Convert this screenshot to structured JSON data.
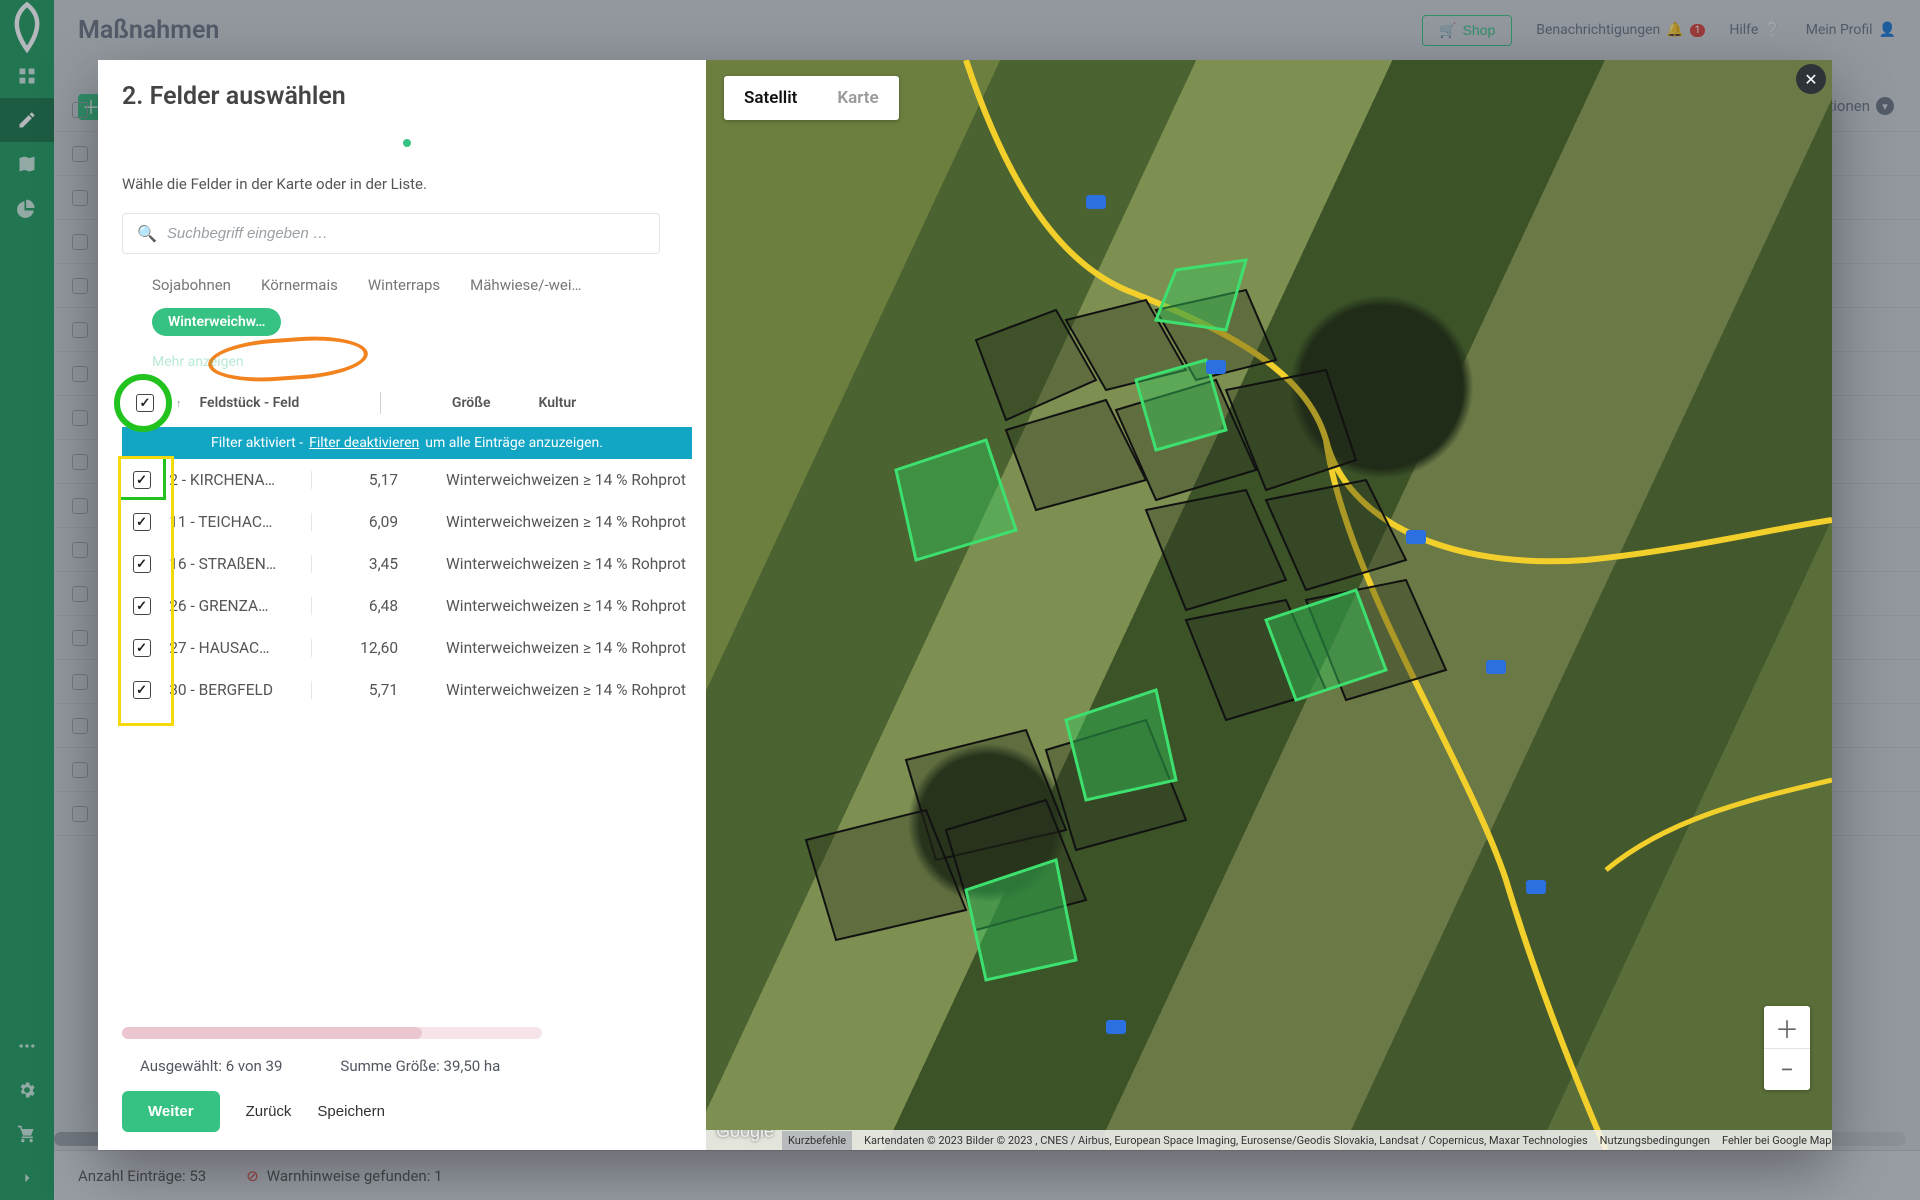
{
  "header": {
    "title": "Maßnahmen",
    "shop": "Shop",
    "notifications": "Benachrichtigungen",
    "notif_badge": "1",
    "help": "Hilfe",
    "profile": "Mein Profil",
    "actions": "tionen"
  },
  "modal": {
    "title": "2. Felder auswählen",
    "hint": "Wähle die Felder in der Karte oder in der Liste.",
    "search_placeholder": "Suchbegriff eingeben …",
    "crop_filters": [
      "Sojabohnen",
      "Körnermais",
      "Winterraps",
      "Mähwiese/-wei…"
    ],
    "crop_active": "Winterweichw…",
    "show_more": "Mehr anzeigen",
    "columns": {
      "field": "Feldstück - Feld",
      "size": "Größe",
      "culture": "Kultur"
    },
    "filter_banner": {
      "pre": "Filter aktiviert - ",
      "link": "Filter deaktivieren",
      "post": " um alle Einträge anzuzeigen."
    },
    "rows": [
      {
        "field": "2 - KIRCHENA…",
        "size": "5,17",
        "culture": "Winterweichweizen ≥ 14 % Rohprot"
      },
      {
        "field": "11 - TEICHAC…",
        "size": "6,09",
        "culture": "Winterweichweizen ≥ 14 % Rohprot"
      },
      {
        "field": "16 - STRAßEN…",
        "size": "3,45",
        "culture": "Winterweichweizen ≥ 14 % Rohprot"
      },
      {
        "field": "26 - GRENZA…",
        "size": "6,48",
        "culture": "Winterweichweizen ≥ 14 % Rohprot"
      },
      {
        "field": "27 - HAUSAC…",
        "size": "12,60",
        "culture": "Winterweichweizen ≥ 14 % Rohprot"
      },
      {
        "field": "30 - BERGFELD",
        "size": "5,71",
        "culture": "Winterweichweizen ≥ 14 % Rohprot"
      }
    ],
    "selected_summary": "Ausgewählt: 6 von 39",
    "sum_summary": "Summe Größe: 39,50 ha",
    "btn_next": "Weiter",
    "btn_back": "Zurück",
    "btn_save": "Speichern"
  },
  "map": {
    "tab_sat": "Satellit",
    "tab_map": "Karte",
    "attrib_kb": "Kurzbefehle",
    "attrib_data": "Kartendaten © 2023 Bilder © 2023 , CNES / Airbus, European Space Imaging, Eurosense/Geodis Slovakia, Landsat / Copernicus, Maxar Technologies",
    "attrib_terms": "Nutzungsbedingungen",
    "attrib_report": "Fehler bei Google Maps melden",
    "google": "Google"
  },
  "footer": {
    "count": "Anzahl Einträge: 53",
    "warn": "Warnhinweise gefunden: 1"
  }
}
